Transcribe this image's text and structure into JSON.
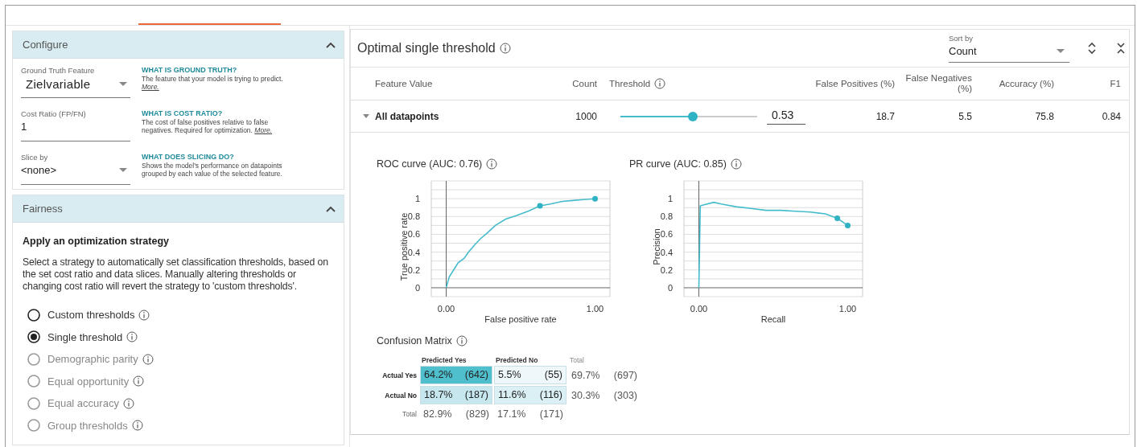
{
  "configure": {
    "title": "Configure",
    "expanded": true,
    "fields": [
      {
        "label": "Ground Truth Feature",
        "value": "Zielvariable",
        "kind": "dropdown",
        "help": {
          "title": "WHAT IS GROUND TRUTH?",
          "text": "The feature that your model is trying to predict.",
          "link": "More."
        }
      },
      {
        "label": "Cost Ratio (FP/FN)",
        "value": "1",
        "kind": "input",
        "help": {
          "title": "WHAT IS COST RATIO?",
          "text": "The cost of false positives relative to false negatives. Required for optimization.",
          "link": "More."
        }
      },
      {
        "label": "Slice by",
        "value": "<none>",
        "kind": "dropdown",
        "help": {
          "title": "WHAT DOES SLICING DO?",
          "text": "Shows the model's performance on datapoints grouped by each value of the selected feature."
        }
      }
    ]
  },
  "fairness": {
    "title": "Fairness",
    "expanded": true,
    "heading": "Apply an optimization strategy",
    "description": "Select a strategy to automatically set classification thresholds, based on the set cost ratio and data slices. Manually altering thresholds or changing cost ratio will revert the strategy to 'custom thresholds'.",
    "strategies": [
      {
        "label": "Custom thresholds",
        "selected": false,
        "disabled": false
      },
      {
        "label": "Single threshold",
        "selected": true,
        "disabled": false
      },
      {
        "label": "Demographic parity",
        "selected": false,
        "disabled": true
      },
      {
        "label": "Equal opportunity",
        "selected": false,
        "disabled": true
      },
      {
        "label": "Equal accuracy",
        "selected": false,
        "disabled": true
      },
      {
        "label": "Group thresholds",
        "selected": false,
        "disabled": true
      }
    ]
  },
  "threshold_panel": {
    "title": "Optimal single threshold",
    "sort_by": {
      "label": "Sort by",
      "value": "Count"
    },
    "columns": [
      {
        "label": "Feature Value",
        "info": false
      },
      {
        "label": "Count",
        "info": false
      },
      {
        "label": "Threshold",
        "info": true
      },
      {
        "label": "False Positives (%)",
        "info": false
      },
      {
        "label": "False Negatives (%)",
        "info": false
      },
      {
        "label": "Accuracy (%)",
        "info": false
      },
      {
        "label": "F1",
        "info": false
      }
    ],
    "rows": [
      {
        "feature_value": "All datapoints",
        "expanded": true,
        "count": "1000",
        "threshold": {
          "level": 0.53,
          "value": "0.53"
        },
        "false_positives": "18.7",
        "false_negatives": "5.5",
        "accuracy": "75.8",
        "f1": "0.84"
      }
    ],
    "roc": {
      "chart_data": {
        "type": "line",
        "title": "ROC curve (AUC: 0.76)",
        "xlabel": "False positive rate",
        "ylabel": "True positive rate",
        "x": [
          0,
          0.02,
          0.05,
          0.08,
          0.12,
          0.15,
          0.19,
          0.23,
          0.28,
          0.33,
          0.4,
          0.47,
          0.55,
          0.63,
          0.7,
          0.78,
          0.85,
          0.92,
          1
        ],
        "series": [
          {
            "color": "#45bccb",
            "values": [
              0,
              0.12,
              0.2,
              0.28,
              0.33,
              0.4,
              0.48,
              0.55,
              0.62,
              0.7,
              0.77,
              0.81,
              0.86,
              0.92,
              0.94,
              0.97,
              0.98,
              0.99,
              1
            ]
          },
          {
            "color": "#2fb3c4",
            "marker": "circle",
            "values": [
              null,
              null,
              null,
              null,
              null,
              null,
              null,
              null,
              null,
              null,
              null,
              null,
              null,
              0.92,
              null,
              null,
              null,
              null,
              null
            ]
          },
          {
            "color": "#2fb3c4",
            "marker": "circle",
            "values": [
              null,
              null,
              null,
              null,
              null,
              null,
              null,
              null,
              null,
              null,
              null,
              null,
              null,
              null,
              null,
              null,
              null,
              null,
              1
            ]
          }
        ],
        "xlim": [
          -0.1,
          1.1
        ],
        "ylim": [
          -0.1,
          1.2
        ],
        "xticks": [
          {
            "value": 0,
            "label": "0.00"
          },
          {
            "value": 1,
            "label": "1.00"
          }
        ],
        "yticks": [
          0,
          0.2,
          0.4,
          0.6,
          0.8,
          1
        ],
        "grid": true
      }
    },
    "pr": {
      "chart_data": {
        "type": "line",
        "title": "PR curve (AUC: 0.85)",
        "xlabel": "Recall",
        "ylabel": "Precision",
        "x": [
          0,
          0.01,
          0.03,
          0.1,
          0.15,
          0.25,
          0.35,
          0.45,
          0.55,
          0.65,
          0.75,
          0.85,
          0.93,
          1
        ],
        "series": [
          {
            "color": "#45bccb",
            "values": [
              0,
              0.92,
              0.93,
              0.96,
              0.94,
              0.91,
              0.89,
              0.87,
              0.87,
              0.86,
              0.85,
              0.83,
              0.78,
              0.7
            ]
          },
          {
            "color": "#2fb3c4",
            "marker": "circle",
            "values": [
              null,
              null,
              null,
              null,
              null,
              null,
              null,
              null,
              null,
              null,
              null,
              null,
              0.78,
              null
            ]
          },
          {
            "color": "#2fb3c4",
            "marker": "circle",
            "values": [
              null,
              null,
              null,
              null,
              null,
              null,
              null,
              null,
              null,
              null,
              null,
              null,
              null,
              0.7
            ]
          }
        ],
        "xlim": [
          -0.1,
          1.1
        ],
        "ylim": [
          -0.1,
          1.2
        ],
        "xticks": [
          {
            "value": 0,
            "label": "0.00"
          },
          {
            "value": 1,
            "label": "1.00"
          }
        ],
        "yticks": [
          0,
          0.2,
          0.4,
          0.6,
          0.8,
          1
        ],
        "grid": true
      }
    },
    "confusion_matrix": {
      "title": "Confusion Matrix",
      "column_headers": [
        "Predicted Yes",
        "Predicted No",
        "Total"
      ],
      "rows": [
        {
          "label": "Actual Yes",
          "cells": [
            {
              "percent": "64.2%",
              "count": "(642)",
              "color": "#4fbfcd"
            },
            {
              "percent": "5.5%",
              "count": "(55)",
              "color": "#eef8fa"
            }
          ],
          "total": {
            "percent": "69.7%",
            "count": "(697)"
          }
        },
        {
          "label": "Actual No",
          "cells": [
            {
              "percent": "18.7%",
              "count": "(187)",
              "color": "#c6e7ee"
            },
            {
              "percent": "11.6%",
              "count": "(116)",
              "color": "#dbf0f4"
            }
          ],
          "total": {
            "percent": "30.3%",
            "count": "(303)"
          }
        }
      ],
      "totals": {
        "label": "Total",
        "cells": [
          {
            "percent": "82.9%",
            "count": "(829)"
          },
          {
            "percent": "17.1%",
            "count": "(171)"
          }
        ]
      }
    }
  }
}
